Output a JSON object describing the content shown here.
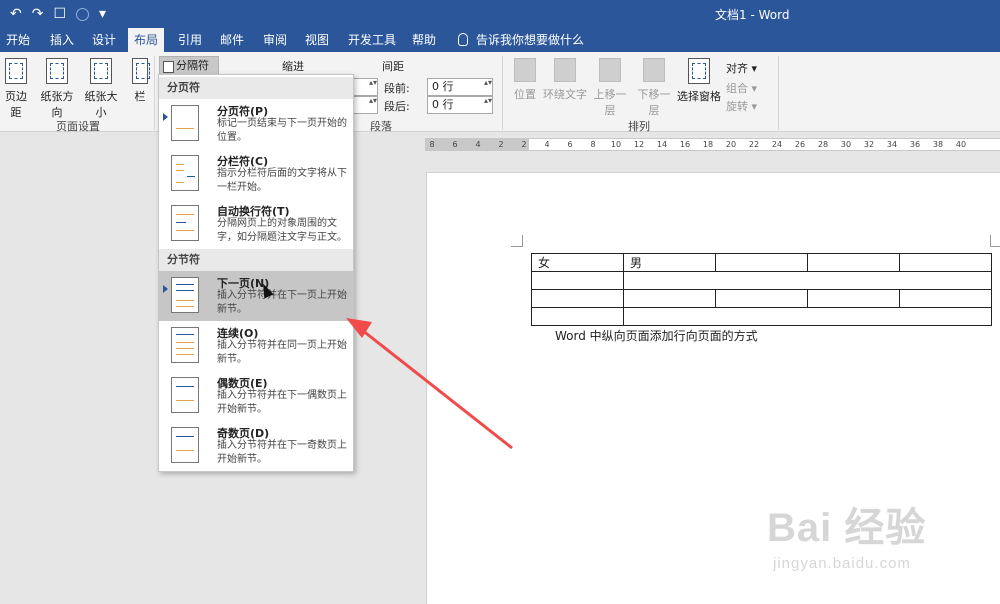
{
  "window": {
    "title": "文档1  -  Word"
  },
  "qat": {
    "save": "↶",
    "redo": "↷",
    "touch": "☐",
    "customize": "▾"
  },
  "tabs": [
    {
      "label": "开始"
    },
    {
      "label": "插入"
    },
    {
      "label": "设计"
    },
    {
      "label": "布局"
    },
    {
      "label": "引用"
    },
    {
      "label": "邮件"
    },
    {
      "label": "审阅"
    },
    {
      "label": "视图"
    },
    {
      "label": "开发工具"
    },
    {
      "label": "帮助"
    }
  ],
  "tell_me": "告诉我你想要做什么",
  "ribbon": {
    "margins": "页边距",
    "orientation": "纸张方向",
    "size": "纸张大小",
    "columns": "栏",
    "breaks": "分隔符 ▾",
    "page_setup_label": "页面设置",
    "indent_label": "缩进",
    "spacing_label": "间距",
    "before_label": "段前:",
    "before_value": "0 行",
    "after_label": "段后:",
    "after_value": "0 行",
    "paragraph_label": "段落",
    "position": "位置",
    "wrap": "环绕文字",
    "bring_forward": "上移一层",
    "send_backward": "下移一层",
    "selection_pane": "选择窗格",
    "align": "对齐 ▾",
    "group": "组合 ▾",
    "rotate": "旋转 ▾",
    "arrange_label": "排列"
  },
  "ruler": {
    "ticks": [
      "8",
      "6",
      "4",
      "2",
      "2",
      "4",
      "6",
      "8",
      "10",
      "12",
      "14",
      "16",
      "18",
      "20",
      "22",
      "24",
      "26",
      "28",
      "30",
      "32",
      "34",
      "36",
      "38",
      "40"
    ]
  },
  "menu": {
    "header_page": "分页符",
    "header_section": "分节符",
    "items": [
      {
        "title": "分页符(P)",
        "desc": "标记一页结束与下一页开始的位置。"
      },
      {
        "title": "分栏符(C)",
        "desc": "指示分栏符后面的文字将从下一栏开始。"
      },
      {
        "title": "自动换行符(T)",
        "desc": "分隔网页上的对象周围的文字，如分隔题注文字与正文。"
      },
      {
        "title": "下一页(N)",
        "desc": "插入分节符并在下一页上开始新节。"
      },
      {
        "title": "连续(O)",
        "desc": "插入分节符并在同一页上开始新节。"
      },
      {
        "title": "偶数页(E)",
        "desc": "插入分节符并在下一偶数页上开始新节。"
      },
      {
        "title": "奇数页(D)",
        "desc": "插入分节符并在下一奇数页上开始新节。"
      }
    ]
  },
  "document": {
    "cell_female": "女",
    "cell_male": "男",
    "caption": "Word 中纵向页面添加行向页面的方式"
  },
  "watermark": {
    "main": "Bai 经验",
    "sub": "jingyan.baidu.com"
  },
  "colors": {
    "brand": "#2b579a",
    "highlight": "#c6c6c6",
    "arrow": "#f04a4a"
  }
}
